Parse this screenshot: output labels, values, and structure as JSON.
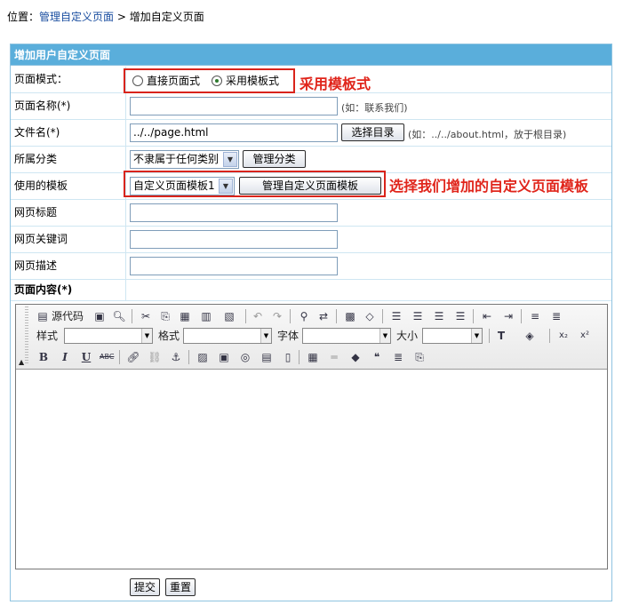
{
  "breadcrumb": {
    "prefix": "位置：",
    "link": "管理自定义页面",
    "separator": " > ",
    "current": "增加自定义页面"
  },
  "panel": {
    "title": "增加用户自定义页面"
  },
  "form": {
    "page_mode": {
      "label": "页面模式：",
      "option_direct": "直接页面式",
      "option_template": "采用模板式",
      "selected": "采用模板式"
    },
    "page_name": {
      "label": "页面名称(*)",
      "value": "",
      "hint": "(如：联系我们)"
    },
    "file_name": {
      "label": "文件名(*)",
      "value": "../../page.html",
      "button": "选择目录",
      "hint": "(如：../../about.html，放于根目录)"
    },
    "category": {
      "label": "所属分类",
      "selected": "不隶属于任何类别",
      "button": "管理分类"
    },
    "template": {
      "label": "使用的模板",
      "selected": "自定义页面模板1",
      "button": "管理自定义页面模板"
    },
    "page_title": {
      "label": "网页标题",
      "value": ""
    },
    "page_keywords": {
      "label": "网页关键词",
      "value": ""
    },
    "page_description": {
      "label": "网页描述",
      "value": ""
    },
    "content": {
      "label": "页面内容(*)"
    }
  },
  "editor": {
    "source_label": "源代码",
    "style_label": "样式",
    "format_label": "格式",
    "font_label": "字体",
    "size_label": "大小",
    "icons_row1": [
      "source-icon",
      "preview-icon",
      "cut-icon",
      "copy-icon",
      "paste-icon",
      "paste-text-icon",
      "paste-word-icon",
      "undo-icon",
      "redo-icon",
      "find-icon",
      "replace-icon",
      "select-all-icon",
      "remove-format-icon",
      "align-left-icon",
      "align-center-icon",
      "align-right-icon",
      "justify-icon",
      "outdent-icon",
      "indent-icon",
      "ordered-list-icon",
      "unordered-list-icon"
    ],
    "icons_row3": [
      "bold-icon",
      "italic-icon",
      "underline-icon",
      "strike-icon",
      "link-icon",
      "unlink-icon",
      "anchor-icon",
      "image-icon",
      "flash-icon",
      "media-icon",
      "template-icon",
      "new-page-icon",
      "table-icon",
      "hr-icon",
      "smiley-icon",
      "quote-icon",
      "special-char-icon",
      "page-break-icon"
    ]
  },
  "actions": {
    "submit": "提交",
    "reset": "重置"
  },
  "annotations": {
    "mode_note": "采用模板式",
    "template_note": "选择我们增加的自定义页面模板"
  },
  "colors": {
    "header_bg": "#5aaedb",
    "border": "#8fc3e0",
    "annotation_red": "#e0251b",
    "link": "#1a4ea0"
  }
}
